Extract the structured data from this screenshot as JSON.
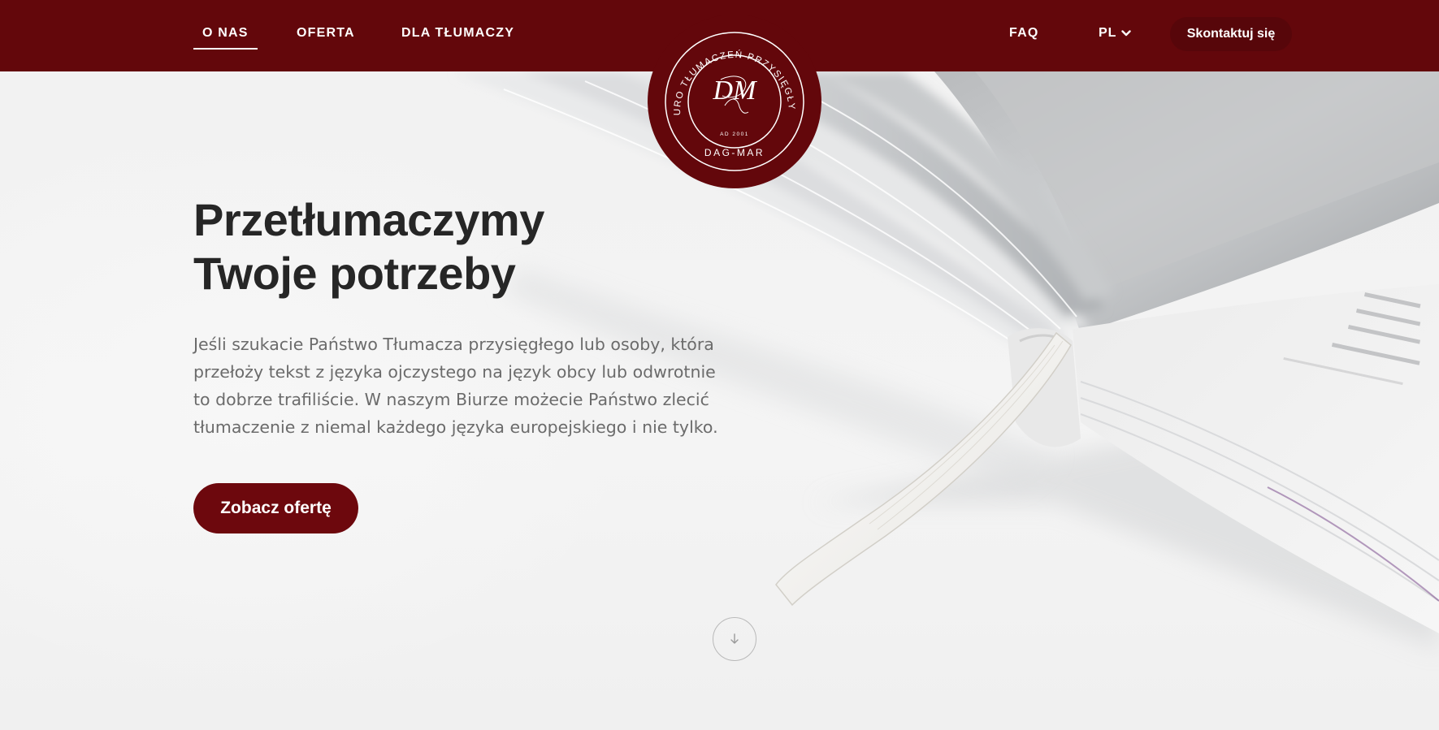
{
  "nav": {
    "items": [
      {
        "label": "O NAS",
        "active": true
      },
      {
        "label": "OFERTA",
        "active": false
      },
      {
        "label": "DLA TŁUMACZY",
        "active": false
      },
      {
        "label": "FAQ",
        "active": false
      }
    ],
    "language": {
      "selected": "PL",
      "icon": "chevron-down-icon"
    },
    "contact_label": "Skontaktuj się"
  },
  "logo": {
    "ring_text": "BIURO TŁUMACZEŃ PRZYSIĘGŁYCH",
    "monogram": "DM",
    "since": "AD 2001",
    "name": "DAG-MAR"
  },
  "hero": {
    "title_lines": [
      "Przetłumaczymy",
      "Twoje potrzeby"
    ],
    "text_lines": [
      "Jeśli szukacie Państwo Tłumacza przysięgłego lub osoby, która",
      "przełoży tekst z języka ojczystego na język obcy lub odwrotnie",
      "to dobrze trafiliście. W naszym Biurze możecie Państwo zlecić",
      "tłumaczenie z niemal każdego języka europejskiego i nie tylko."
    ],
    "cta_label": "Zobacz ofertę"
  },
  "scroll": {
    "icon": "arrow-down-icon"
  },
  "colors": {
    "brand": "#63070b",
    "cta": "#6d080d",
    "heading": "#262626",
    "body_text": "#6b6b6b",
    "background": "#f3f3f3"
  }
}
